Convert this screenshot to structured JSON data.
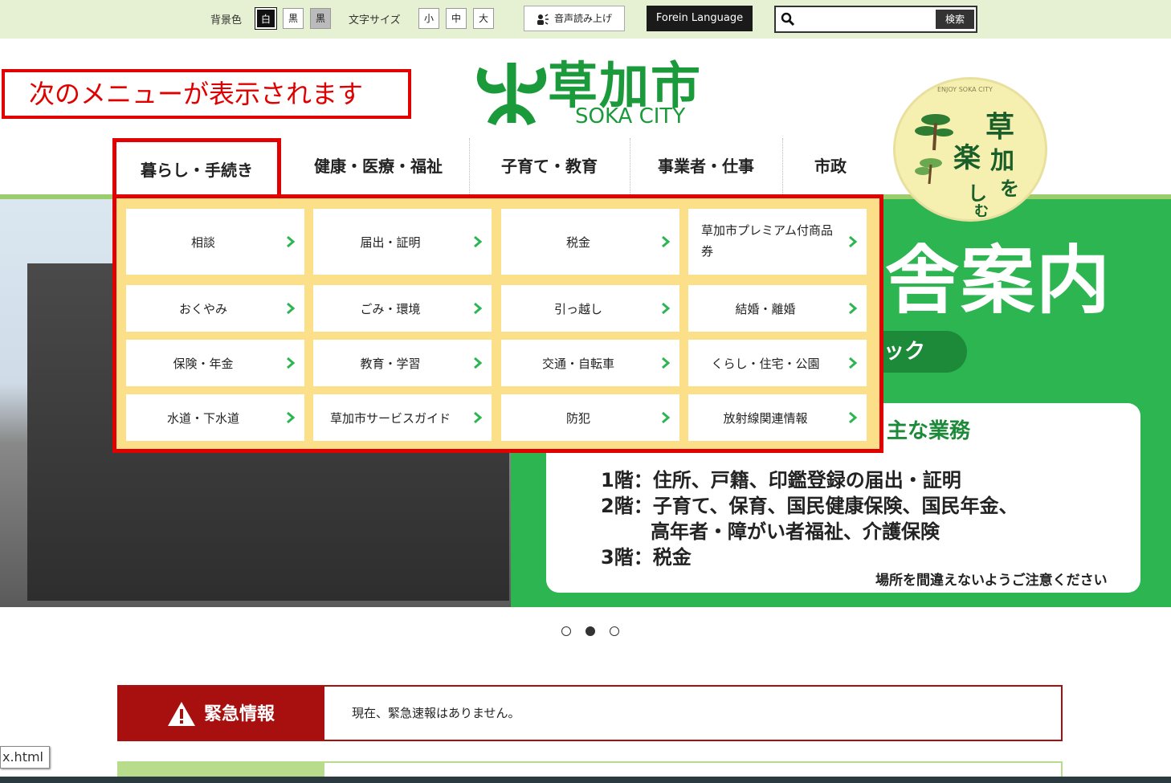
{
  "utility": {
    "bg_label": "背景色",
    "bg_white": "白",
    "bg_black": "黒",
    "bg_gray": "黒",
    "font_label": "文字サイズ",
    "font_small": "小",
    "font_medium": "中",
    "font_large": "大",
    "read_aloud": "音声読み上げ",
    "language": "Forein Language",
    "search_placeholder": "",
    "search_button": "検索"
  },
  "annotation": "次のメニューが表示されます",
  "logo": {
    "title": "草加市",
    "subtitle": "SOKA CITY"
  },
  "badge": {
    "chars": [
      "草",
      "楽",
      "加",
      "を",
      "し",
      "む"
    ],
    "ring_text": "ENJOY SOKA CITY"
  },
  "nav": {
    "items": [
      "暮らし・手続き",
      "健康・医療・福祉",
      "子育て・教育",
      "事業者・仕事",
      "市政"
    ]
  },
  "mega_menu": {
    "items": [
      "相談",
      "届出・証明",
      "税金",
      "草加市プレミアム付商品券",
      "おくやみ",
      "ごみ・環境",
      "引っ越し",
      "結婚・離婚",
      "保険・年金",
      "教育・学習",
      "交通・自転車",
      "くらし・住宅・公園",
      "水道・下水道",
      "草加市サービスガイド",
      "防犯",
      "放射線関連情報"
    ],
    "item4_line1": "草加市プレミアム付商",
    "item4_line2": "品券"
  },
  "hero": {
    "big_text": "舎案内",
    "pill_text": "ック",
    "card_heading": "主な業務",
    "lines": [
      "1階：住所、戸籍、印鑑登録の届出・証明",
      "2階：子育て、保育、国民健康保険、国民年金、",
      "高年者・障がい者福祉、介護保険",
      "3階：税金"
    ],
    "note": "場所を間違えないようご注意ください",
    "slide_active": 2,
    "slide_count": 3
  },
  "emergency": {
    "heading": "緊急情報",
    "message": "現在、緊急速報はありません。"
  },
  "status_tip": "x.html",
  "colors": {
    "brand_green": "#1a9a3a",
    "annotation_red": "#e00000",
    "menu_yellow": "#fbe089",
    "hero_green": "#2db552",
    "emergency_red": "#a81010"
  }
}
